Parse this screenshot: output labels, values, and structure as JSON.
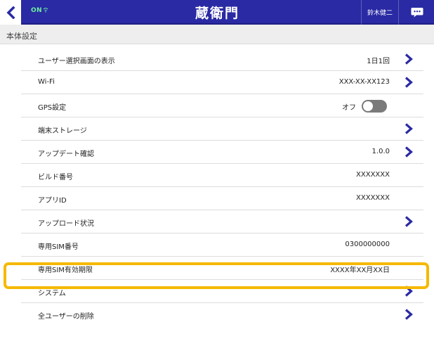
{
  "header": {
    "status": "ON",
    "logo_text": "蔵衛門",
    "user_name": "鈴木健二"
  },
  "section": {
    "title": "本体設定"
  },
  "settings": [
    {
      "label": "ユーザー選択画面の表示",
      "value": "1日1回",
      "chevron": true
    },
    {
      "label": "Wi-Fi",
      "value": "XXX-XX-XX123",
      "chevron": true
    },
    {
      "label": "GPS設定",
      "value": "オフ",
      "toggle": false
    },
    {
      "label": "端末ストレージ",
      "value": "",
      "chevron": true
    },
    {
      "label": "アップデート確認",
      "value": "1.0.0",
      "chevron": true
    },
    {
      "label": "ビルド番号",
      "value": "XXXXXXX"
    },
    {
      "label": "アプリID",
      "value": "XXXXXXX"
    },
    {
      "label": "アップロード状況",
      "value": "",
      "chevron": true
    },
    {
      "label": "専用SIM番号",
      "value": "0300000000"
    },
    {
      "label": "専用SIM有効期限",
      "value": "XXXX年XX月XX日",
      "highlighted": true
    },
    {
      "label": "システム",
      "value": "",
      "chevron": true
    },
    {
      "label": "全ユーザーの削除",
      "value": "",
      "chevron": true
    }
  ],
  "colors": {
    "header_bg": "#2a2aa4",
    "highlight_border": "#f6b900",
    "chevron": "#2a2aa4"
  }
}
